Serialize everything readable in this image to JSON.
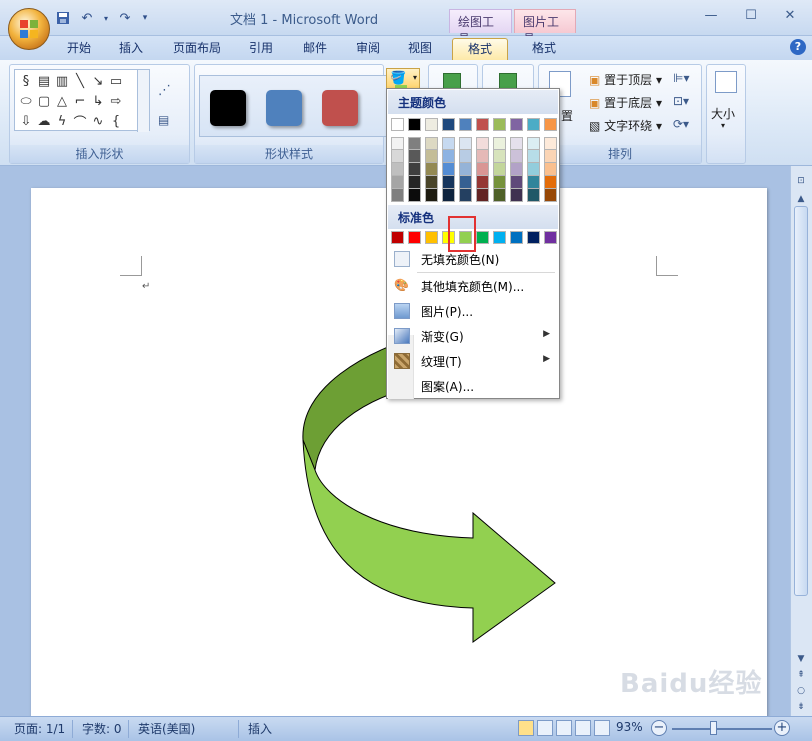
{
  "window": {
    "title": "文档 1 - Microsoft Word",
    "contextual_tab_drawing": "绘图工具",
    "contextual_tab_picture": "图片工具",
    "minimize": "—",
    "maximize": "☐",
    "close": "✕"
  },
  "tabs": [
    "开始",
    "插入",
    "页面布局",
    "引用",
    "邮件",
    "审阅",
    "视图",
    "格式",
    "格式"
  ],
  "ribbon": {
    "group_insert_shapes": "插入形状",
    "group_shape_styles": "形状样式",
    "group_arrange": "排列",
    "bring_to_front": "置于顶层",
    "send_to_back": "置于底层",
    "text_wrap": "文字环绕",
    "position_label": "置",
    "size_label": "大小",
    "style_colors": [
      "#000000",
      "#4f81bd",
      "#c0504d"
    ]
  },
  "dropdown": {
    "theme_colors_title": "主题颜色",
    "standard_colors_title": "标准色",
    "theme_colors": [
      "#ffffff",
      "#000000",
      "#eeece1",
      "#1f497d",
      "#4f81bd",
      "#c0504d",
      "#9bbb59",
      "#8064a2",
      "#4bacc6",
      "#f79646"
    ],
    "theme_shades": [
      [
        "#f2f2f2",
        "#d8d8d8",
        "#bfbfbf",
        "#a5a5a5",
        "#7f7f7f"
      ],
      [
        "#7f7f7f",
        "#595959",
        "#3f3f3f",
        "#262626",
        "#0c0c0c"
      ],
      [
        "#ddd9c3",
        "#c4bd97",
        "#938953",
        "#494429",
        "#1d1b10"
      ],
      [
        "#c6d9f0",
        "#8db3e2",
        "#548dd4",
        "#17365d",
        "#0f243e"
      ],
      [
        "#dbe5f1",
        "#b8cce4",
        "#95b3d7",
        "#366092",
        "#244061"
      ],
      [
        "#f2dcdb",
        "#e5b9b7",
        "#d99694",
        "#953734",
        "#632423"
      ],
      [
        "#ebf1dd",
        "#d7e3bc",
        "#c3d69b",
        "#76923c",
        "#4f6128"
      ],
      [
        "#e5e0ec",
        "#ccc1d9",
        "#b2a2c7",
        "#5f497a",
        "#3f3151"
      ],
      [
        "#dbeef3",
        "#b7dde8",
        "#92cddc",
        "#31859b",
        "#205867"
      ],
      [
        "#fdeada",
        "#fbd5b5",
        "#fac08f",
        "#e36c09",
        "#974806"
      ]
    ],
    "standard_colors": [
      "#c00000",
      "#ff0000",
      "#ffc000",
      "#ffff00",
      "#92d050",
      "#00b050",
      "#00b0f0",
      "#0070c0",
      "#002060",
      "#7030a0"
    ],
    "no_fill": "无填充颜色(N)",
    "more_colors": "其他填充颜色(M)...",
    "picture": "图片(P)...",
    "gradient": "渐变(G)",
    "texture": "纹理(T)",
    "pattern": "图案(A)..."
  },
  "status": {
    "page": "页面: 1/1",
    "words": "字数: 0",
    "language": "英语(美国)",
    "insert_mode": "插入",
    "zoom": "93%"
  },
  "shape": {
    "fill_light": "#92d050",
    "fill_dark": "#6d9f34"
  },
  "watermark": "Baidu经验"
}
